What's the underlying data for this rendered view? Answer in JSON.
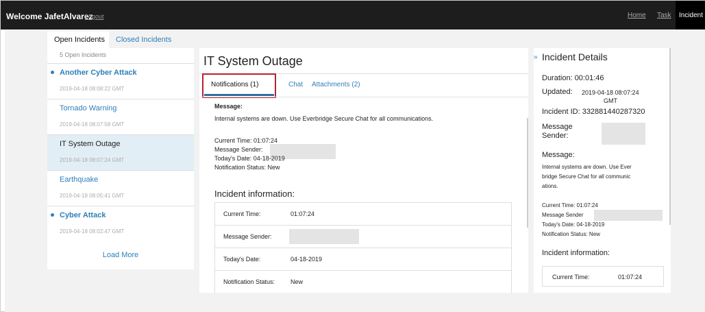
{
  "topbar": {
    "welcome": "Welcome JafetAlvarez",
    "logout": "Logout",
    "nav": {
      "home": "Home",
      "task": "Task",
      "incident": "Incident"
    }
  },
  "sidebar": {
    "tabs": {
      "open": "Open Incidents",
      "closed": "Closed Incidents"
    },
    "count": "5 Open Incidents",
    "items": [
      {
        "title": "Another Cyber Attack",
        "date": "2019-04-18 08:08:22 GMT",
        "unread": true
      },
      {
        "title": "Tornado Warning",
        "date": "2019-04-18 08:07:58 GMT",
        "unread": false
      },
      {
        "title": "IT System Outage",
        "date": "2019-04-18 08:07:24 GMT",
        "unread": false,
        "selected": true
      },
      {
        "title": "Earthquake",
        "date": "2019-04-18 08:05:41 GMT",
        "unread": false
      },
      {
        "title": "Cyber Attack",
        "date": "2019-04-18 08:02:47 GMT",
        "unread": true
      }
    ],
    "load_more": "Load More"
  },
  "main": {
    "title": "IT System Outage",
    "tabs": {
      "notifications": "Notifications (1)",
      "chat": "Chat",
      "attachments": "Attachments (2)"
    },
    "message_label": "Message:",
    "message": "Internal systems are down. Use Everbridge Secure Chat for all communications.",
    "current_time": "Current Time: 01:07:24",
    "sender": "Message Sender:",
    "date": "Today's Date: 04-18-2019",
    "status": "Notification Status: New",
    "incident_info_heading": "Incident information:",
    "info_rows": [
      {
        "key": "Current Time:",
        "value": "01:07:24"
      },
      {
        "key": "Message Sender:",
        "value": ""
      },
      {
        "key": "Today's Date:",
        "value": "04-18-2019"
      },
      {
        "key": "Notification Status:",
        "value": "New"
      }
    ]
  },
  "details": {
    "chevron": "»",
    "title": "Incident Details",
    "duration": "Duration: 00:01:46",
    "updated_label": "Updated:",
    "updated_value": "2019-04-18 08:07:24",
    "updated_tz": "GMT",
    "incident_id": "Incident ID: 332881440287320",
    "sender_label_1": "Message",
    "sender_label_2": "Sender:",
    "message_label": "Message:",
    "message_lines": [
      "Internal systems are down. Use Ever",
      "bridge Secure Chat for all communic",
      "ations."
    ],
    "current_time": "Current Time: 01:07:24",
    "sender": "Message Sender",
    "date": "Today's Date: 04-18-2019",
    "status": "Notification Status: New",
    "incident_info_heading": "Incident information:",
    "info_key": "Current Time:",
    "info_value": "01:07:24"
  }
}
